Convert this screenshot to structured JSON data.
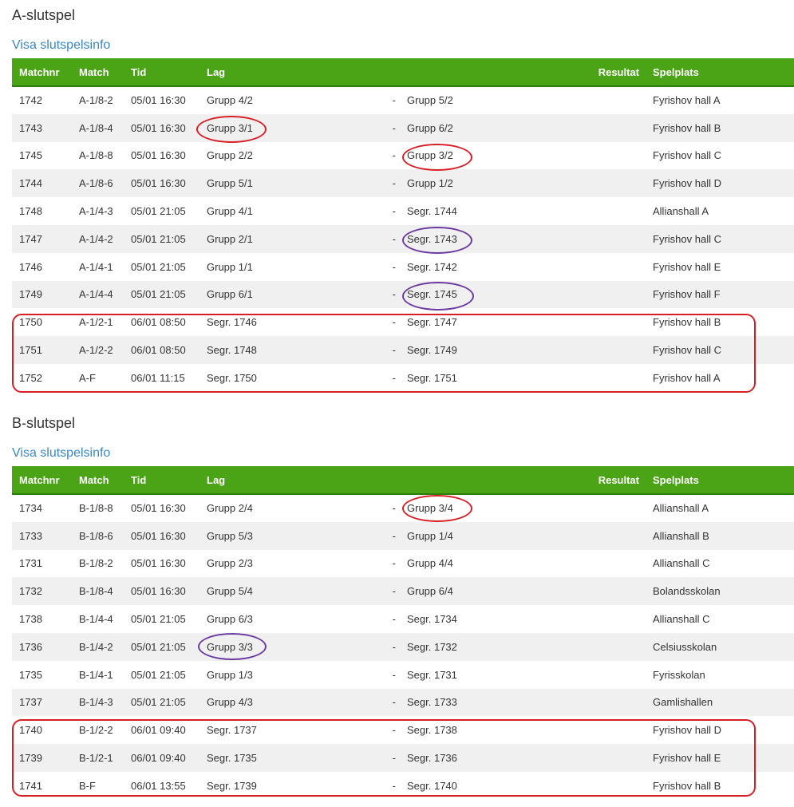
{
  "sections": [
    {
      "title": "A-slutspel",
      "link": "Visa slutspelsinfo",
      "headers": {
        "matchnr": "Matchnr",
        "match": "Match",
        "tid": "Tid",
        "lag": "Lag",
        "resultat": "Resultat",
        "spelplats": "Spelplats"
      },
      "rows": [
        {
          "nr": "1742",
          "match": "A-1/8-2",
          "tid": "05/01 16:30",
          "home": "Grupp 4/2",
          "sep": "-",
          "away": "Grupp 5/2",
          "venue": "Fyrishov hall A"
        },
        {
          "nr": "1743",
          "match": "A-1/8-4",
          "tid": "05/01 16:30",
          "home": "Grupp 3/1",
          "sep": "-",
          "away": "Grupp 6/2",
          "venue": "Fyrishov hall B"
        },
        {
          "nr": "1745",
          "match": "A-1/8-8",
          "tid": "05/01 16:30",
          "home": "Grupp 2/2",
          "sep": "-",
          "away": "Grupp 3/2",
          "venue": "Fyrishov hall C"
        },
        {
          "nr": "1744",
          "match": "A-1/8-6",
          "tid": "05/01 16:30",
          "home": "Grupp 5/1",
          "sep": "-",
          "away": "Grupp 1/2",
          "venue": "Fyrishov hall D"
        },
        {
          "nr": "1748",
          "match": "A-1/4-3",
          "tid": "05/01 21:05",
          "home": "Grupp 4/1",
          "sep": "-",
          "away": "Segr. 1744",
          "venue": "Allianshall A"
        },
        {
          "nr": "1747",
          "match": "A-1/4-2",
          "tid": "05/01 21:05",
          "home": "Grupp 2/1",
          "sep": "-",
          "away": "Segr. 1743",
          "venue": "Fyrishov hall C"
        },
        {
          "nr": "1746",
          "match": "A-1/4-1",
          "tid": "05/01 21:05",
          "home": "Grupp 1/1",
          "sep": "-",
          "away": "Segr. 1742",
          "venue": "Fyrishov hall E"
        },
        {
          "nr": "1749",
          "match": "A-1/4-4",
          "tid": "05/01 21:05",
          "home": "Grupp 6/1",
          "sep": "-",
          "away": "Segr. 1745",
          "venue": "Fyrishov hall F"
        },
        {
          "nr": "1750",
          "match": "A-1/2-1",
          "tid": "06/01 08:50",
          "home": "Segr. 1746",
          "sep": "-",
          "away": "Segr. 1747",
          "venue": "Fyrishov hall B"
        },
        {
          "nr": "1751",
          "match": "A-1/2-2",
          "tid": "06/01 08:50",
          "home": "Segr. 1748",
          "sep": "-",
          "away": "Segr. 1749",
          "venue": "Fyrishov hall C"
        },
        {
          "nr": "1752",
          "match": "A-F",
          "tid": "06/01 11:15",
          "home": "Segr. 1750",
          "sep": "-",
          "away": "Segr. 1751",
          "venue": "Fyrishov hall A"
        }
      ]
    },
    {
      "title": "B-slutspel",
      "link": "Visa slutspelsinfo",
      "headers": {
        "matchnr": "Matchnr",
        "match": "Match",
        "tid": "Tid",
        "lag": "Lag",
        "resultat": "Resultat",
        "spelplats": "Spelplats"
      },
      "rows": [
        {
          "nr": "1734",
          "match": "B-1/8-8",
          "tid": "05/01 16:30",
          "home": "Grupp 2/4",
          "sep": "-",
          "away": "Grupp 3/4",
          "venue": "Allianshall A"
        },
        {
          "nr": "1733",
          "match": "B-1/8-6",
          "tid": "05/01 16:30",
          "home": "Grupp 5/3",
          "sep": "-",
          "away": "Grupp 1/4",
          "venue": "Allianshall B"
        },
        {
          "nr": "1731",
          "match": "B-1/8-2",
          "tid": "05/01 16:30",
          "home": "Grupp 2/3",
          "sep": "-",
          "away": "Grupp 4/4",
          "venue": "Allianshall C"
        },
        {
          "nr": "1732",
          "match": "B-1/8-4",
          "tid": "05/01 16:30",
          "home": "Grupp 5/4",
          "sep": "-",
          "away": "Grupp 6/4",
          "venue": "Bolandsskolan"
        },
        {
          "nr": "1738",
          "match": "B-1/4-4",
          "tid": "05/01 21:05",
          "home": "Grupp 6/3",
          "sep": "-",
          "away": "Segr. 1734",
          "venue": "Allianshall C"
        },
        {
          "nr": "1736",
          "match": "B-1/4-2",
          "tid": "05/01 21:05",
          "home": "Grupp 3/3",
          "sep": "-",
          "away": "Segr. 1732",
          "venue": "Celsiusskolan"
        },
        {
          "nr": "1735",
          "match": "B-1/4-1",
          "tid": "05/01 21:05",
          "home": "Grupp 1/3",
          "sep": "-",
          "away": "Segr. 1731",
          "venue": "Fyrisskolan"
        },
        {
          "nr": "1737",
          "match": "B-1/4-3",
          "tid": "05/01 21:05",
          "home": "Grupp 4/3",
          "sep": "-",
          "away": "Segr. 1733",
          "venue": "Gamlishallen"
        },
        {
          "nr": "1740",
          "match": "B-1/2-2",
          "tid": "06/01 09:40",
          "home": "Segr. 1737",
          "sep": "-",
          "away": "Segr. 1738",
          "venue": "Fyrishov hall D"
        },
        {
          "nr": "1739",
          "match": "B-1/2-1",
          "tid": "06/01 09:40",
          "home": "Segr. 1735",
          "sep": "-",
          "away": "Segr. 1736",
          "venue": "Fyrishov hall E"
        },
        {
          "nr": "1741",
          "match": "B-F",
          "tid": "06/01 13:55",
          "home": "Segr. 1739",
          "sep": "-",
          "away": "Segr. 1740",
          "venue": "Fyrishov hall B"
        }
      ]
    }
  ],
  "colors": {
    "header_green": "#4aa416",
    "link_blue": "#3a88c8",
    "annotation_red": "#d91f26",
    "annotation_purple": "#6a3aa1",
    "row_stripe": "#f0f0f0"
  }
}
